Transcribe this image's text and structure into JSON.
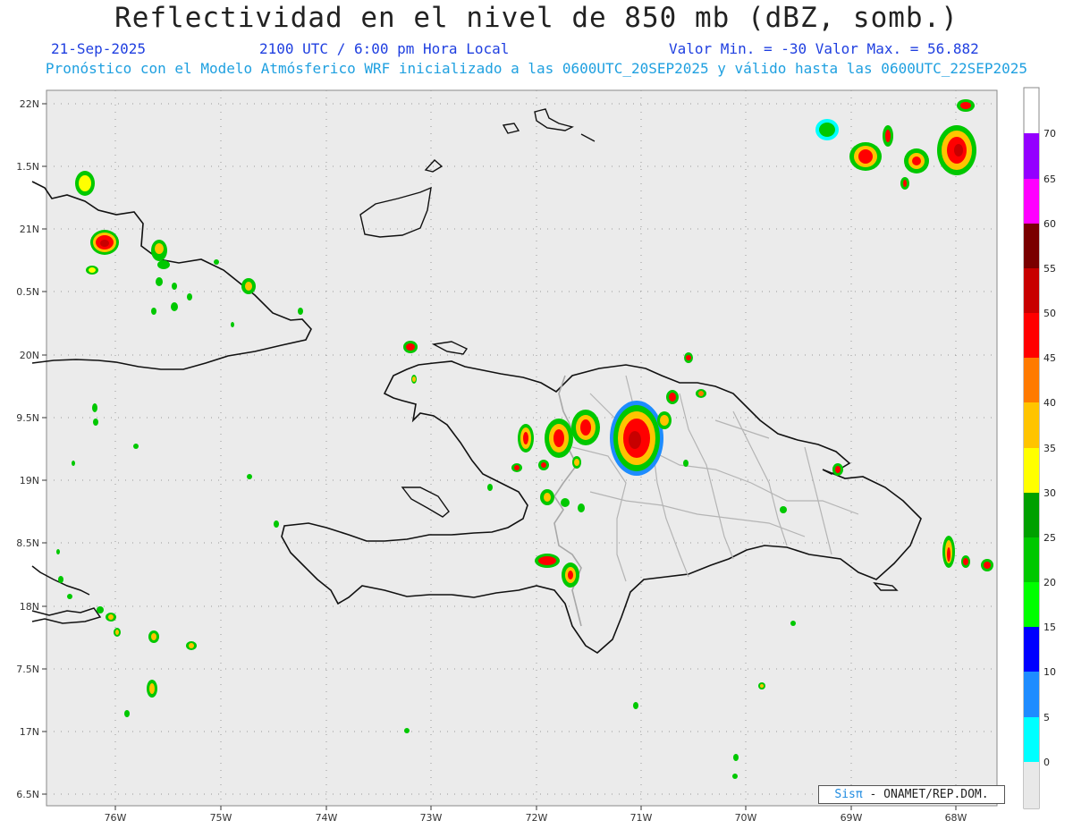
{
  "header": {
    "title": "Reflectividad en el nivel de 850 mb (dBZ, somb.)",
    "date": "21-Sep-2025",
    "time": "2100 UTC / 6:00 pm Hora Local",
    "minmax": "Valor Min. = -30  Valor Max. = 56.882",
    "description": "Pronóstico con el Modelo Atmósferico WRF inicializado a las 0600UTC_20SEP2025 y válido hasta las  0600UTC_22SEP2025"
  },
  "axes": {
    "lat_labels": [
      "22N",
      "1.5N",
      "21N",
      "0.5N",
      "20N",
      "9.5N",
      "19N",
      "8.5N",
      "18N",
      "7.5N",
      "17N",
      "6.5N"
    ],
    "lon_labels": [
      "76W",
      "75W",
      "74W",
      "73W",
      "72W",
      "71W",
      "70W",
      "69W",
      "68W"
    ]
  },
  "colorbar": {
    "labels": [
      "70",
      "65",
      "60",
      "55",
      "50",
      "45",
      "40",
      "35",
      "30",
      "25",
      "20",
      "15",
      "10",
      "5",
      "0"
    ],
    "colors": [
      "#9400ff",
      "#ff00ff",
      "#7a0000",
      "#c80000",
      "#ff0000",
      "#ff7a00",
      "#ffc400",
      "#ffff00",
      "#00a000",
      "#00c800",
      "#00ff00",
      "#0000ff",
      "#1e8cff",
      "#00ffff",
      "#e8e8e8"
    ]
  },
  "credit": {
    "brand": "Sisπ",
    "text": " - ONAMET/REP.DOM."
  },
  "colors": {
    "ocean": "#ebebeb",
    "coast": "#111111",
    "borders": "#a8a8a8"
  }
}
